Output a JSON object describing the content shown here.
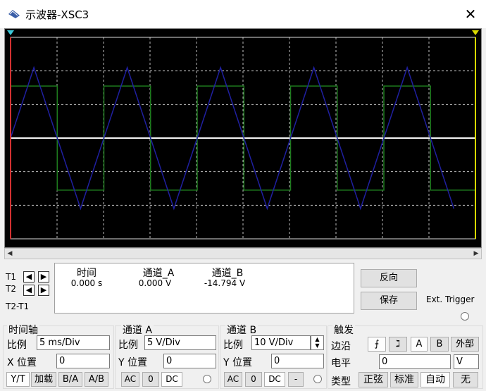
{
  "window": {
    "title": "示波器-XSC3",
    "close_glyph": "✕"
  },
  "cursor_panel": {
    "t1_label": "T1",
    "t2_label": "T2",
    "t2t1_label": "T2-T1",
    "headers": {
      "time": "时间",
      "channel_a": "通道_A",
      "channel_b": "通道_B"
    },
    "values": {
      "time": "0.000 s",
      "channel_a": "0.000 V",
      "channel_b": "-14.794 V"
    }
  },
  "right_buttons": {
    "reverse": "反向",
    "save": "保存",
    "ext_trigger": "Ext. Trigger"
  },
  "timebase": {
    "title": "时间轴",
    "scale_label": "比例",
    "scale_value": "5 ms/Div",
    "xpos_label": "X 位置",
    "xpos_value": "0",
    "modes": [
      "Y/T",
      "加载",
      "B/A",
      "A/B"
    ]
  },
  "channel_a": {
    "title": "通道 A",
    "scale_label": "比例",
    "scale_value": "5  V/Div",
    "ypos_label": "Y 位置",
    "ypos_value": "0",
    "coupling": [
      "AC",
      "0",
      "DC"
    ]
  },
  "channel_b": {
    "title": "通道 B",
    "scale_label": "比例",
    "scale_value": "10  V/Div",
    "ypos_label": "Y 位置",
    "ypos_value": "0",
    "coupling": [
      "AC",
      "0",
      "DC",
      "-"
    ]
  },
  "trigger": {
    "title": "触发",
    "edge_label": "边沿",
    "level_label": "电平",
    "level_value": "0",
    "level_unit": "V",
    "type_label": "类型",
    "edge_buttons": [
      "A",
      "B",
      "外部"
    ],
    "types": [
      "正弦",
      "标准",
      "自动",
      "无"
    ]
  },
  "colors": {
    "grid": "#bdbdbd",
    "channel_a": "#1f1fa0",
    "channel_b": "#1e7a1e",
    "cursor1": "#d23030",
    "cursor2": "#d8d800"
  }
}
